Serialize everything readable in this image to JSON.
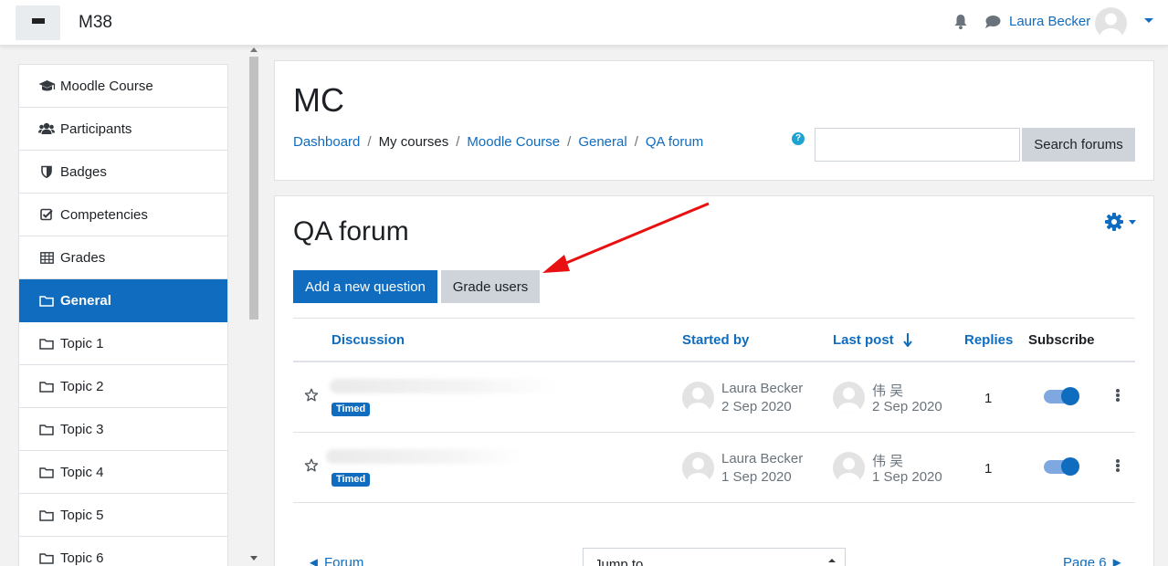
{
  "navbar": {
    "site_name": "M38",
    "user_name": "Laura Becker",
    "icons": [
      "bars-icon",
      "bell-icon",
      "comment-icon",
      "avatar",
      "caret-down-icon"
    ]
  },
  "sidebar": {
    "items": [
      {
        "label": "Moodle Course",
        "icon": "graduation-cap-icon"
      },
      {
        "label": "Participants",
        "icon": "users-icon"
      },
      {
        "label": "Badges",
        "icon": "shield-icon"
      },
      {
        "label": "Competencies",
        "icon": "check-square-icon"
      },
      {
        "label": "Grades",
        "icon": "table-icon"
      },
      {
        "label": "General",
        "icon": "folder-icon"
      },
      {
        "label": "Topic 1",
        "icon": "folder-icon"
      },
      {
        "label": "Topic 2",
        "icon": "folder-icon"
      },
      {
        "label": "Topic 3",
        "icon": "folder-icon"
      },
      {
        "label": "Topic 4",
        "icon": "folder-icon"
      },
      {
        "label": "Topic 5",
        "icon": "folder-icon"
      },
      {
        "label": "Topic 6",
        "icon": "folder-icon"
      }
    ],
    "active_index": 5
  },
  "header": {
    "course_title": "MC",
    "breadcrumb": [
      "Dashboard",
      "My courses",
      "Moodle Course",
      "General",
      "QA forum"
    ],
    "search_button": "Search forums",
    "search_value": ""
  },
  "forum": {
    "title": "QA forum",
    "add_button": "Add a new question",
    "grade_button": "Grade users",
    "columns": {
      "discussion": "Discussion",
      "started_by": "Started by",
      "last_post": "Last post",
      "replies": "Replies",
      "subscribe": "Subscribe"
    },
    "rows": [
      {
        "badge": "Timed",
        "started_by": "Laura Becker",
        "started_date": "2 Sep 2020",
        "last_post_by": "伟 吴",
        "last_post_date": "2 Sep 2020",
        "replies": "1",
        "subscribed": true
      },
      {
        "badge": "Timed",
        "started_by": "Laura Becker",
        "started_date": "1 Sep 2020",
        "last_post_by": "伟 吴",
        "last_post_date": "1 Sep 2020",
        "replies": "1",
        "subscribed": true
      }
    ],
    "prev_link": "◄ Forum",
    "jump_to": "Jump to...",
    "next_link": "Page 6 ►"
  },
  "colors": {
    "primary": "#0f6cbf",
    "annotation_arrow": "#e81010"
  }
}
